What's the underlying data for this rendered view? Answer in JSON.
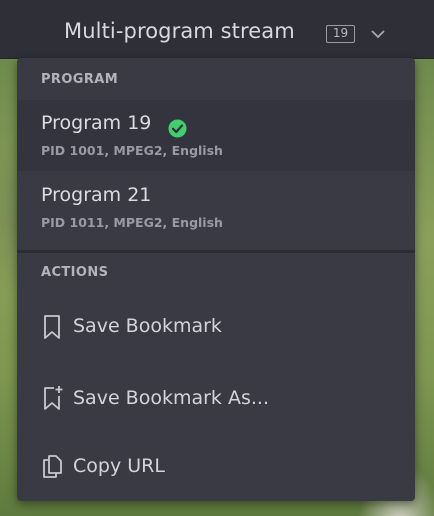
{
  "header": {
    "title": "Multi-program stream",
    "badge": "19",
    "dropdown_icon": "chevron-down-icon"
  },
  "menu": {
    "program_section": "PROGRAM",
    "programs": [
      {
        "title": "Program 19",
        "details": "PID 1001, MPEG2, English",
        "selected": true,
        "status_icon": "check-circle-icon"
      },
      {
        "title": "Program 21",
        "details": "PID 1011, MPEG2, English",
        "selected": false
      }
    ],
    "actions_section": "ACTIONS",
    "actions": [
      {
        "label": "Save Bookmark",
        "icon": "bookmark-icon"
      },
      {
        "label": "Save Bookmark As...",
        "icon": "bookmark-add-icon"
      },
      {
        "label": "Copy URL",
        "icon": "copy-icon"
      }
    ]
  },
  "colors": {
    "menu_bg": "#3a3a44",
    "selected_bg": "#34343e",
    "check_green": "#3fcf6e"
  }
}
